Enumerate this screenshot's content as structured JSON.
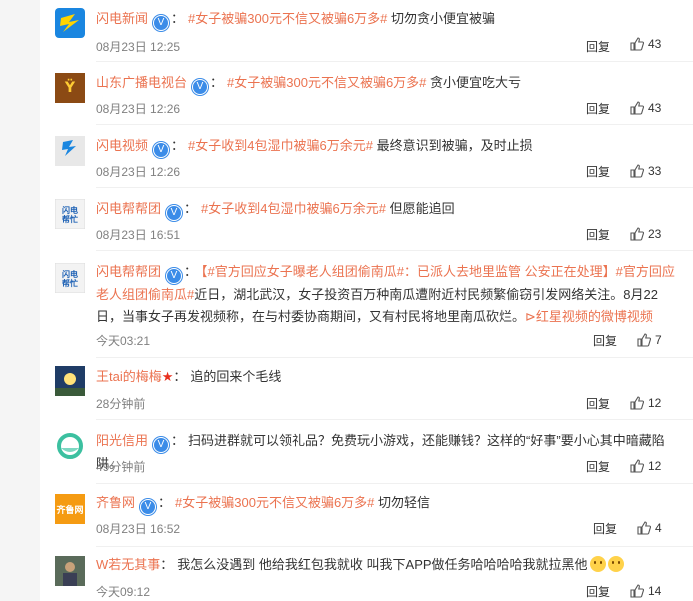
{
  "comments": [
    {
      "name": "闪电新闻",
      "verified": true,
      "topic": "#女子被骗300元不信又被骗6万多#",
      "text": "切勿贪小便宜被骗",
      "time": "08月23日 12:25",
      "reply": "回复",
      "likes": "43",
      "avatar_icon": "shandian-news-logo"
    },
    {
      "name": "山东广播电视台",
      "verified": true,
      "topic": "#女子被骗300元不信又被骗6万多#",
      "text": "贪小便宜吃大亏",
      "time": "08月23日 12:26",
      "reply": "回复",
      "likes": "43",
      "avatar_icon": "sdtv-logo"
    },
    {
      "name": "闪电视频",
      "verified": true,
      "topic": "#女子收到4包湿巾被骗6万余元#",
      "text": "最终意识到被骗，及时止损",
      "time": "08月23日 12:26",
      "reply": "回复",
      "likes": "33",
      "avatar_icon": "shandian-video-logo",
      "avatar_caption": "闪电视频"
    },
    {
      "name": "闪电帮帮团",
      "verified": true,
      "topic": "#女子收到4包湿巾被骗6万余元#",
      "text": "但愿能追回",
      "time": "08月23日 16:51",
      "reply": "回复",
      "likes": "23",
      "avatar_icon": "bangbangtuan-logo"
    },
    {
      "name": "闪电帮帮团",
      "verified": true,
      "headline": "【#官方回应女子曝老人组团偷南瓜#：已派人去地里监管 公安正在处理】",
      "topic": "#官方回应老人组团偷南瓜#",
      "text": "近日，湖北武汉，女子投资百万种南瓜遭附近村民频繁偷窃引发网络关注。8月22日，当事女子再发视频称，在与村委协商期间，又有村民将地里南瓜砍烂。",
      "link": "红星视频的微博视频",
      "time": "今天03:21",
      "reply": "回复",
      "likes": "7",
      "avatar_icon": "bangbangtuan-logo"
    },
    {
      "name": "王tai的梅梅",
      "text": "追的回来个毛线",
      "time": "28分钟前",
      "reply": "回复",
      "likes": "12",
      "avatar_icon": "night-sky-avatar"
    },
    {
      "name": "阳光信用",
      "verified": true,
      "text": "扫码进群就可以领礼品？免费玩小游戏，还能赚钱？这样的“好事”要小心其中暗藏陷阱。",
      "time": "49分钟前",
      "reply": "回复",
      "likes": "12",
      "avatar_icon": "sunshine-credit-logo"
    },
    {
      "name": "齐鲁网",
      "verified": true,
      "topic": "#女子被骗300元不信又被骗6万多#",
      "text": "切勿轻信",
      "time": "08月23日 16:52",
      "reply": "回复",
      "likes": "4",
      "avatar_icon": "qilu-logo",
      "avatar_caption": "齐鲁网"
    },
    {
      "name": "W若无其事",
      "text": "我怎么没遇到 他给我红包我就收 叫我下APP做任务哈哈哈哈我就拉黑他",
      "time": "今天09:12",
      "reply": "回复",
      "likes": "14",
      "avatar_icon": "photo-avatar"
    }
  ],
  "colors": {
    "accent": "#eb7350",
    "verified": "#3b8ce8",
    "meta": "#808080"
  }
}
